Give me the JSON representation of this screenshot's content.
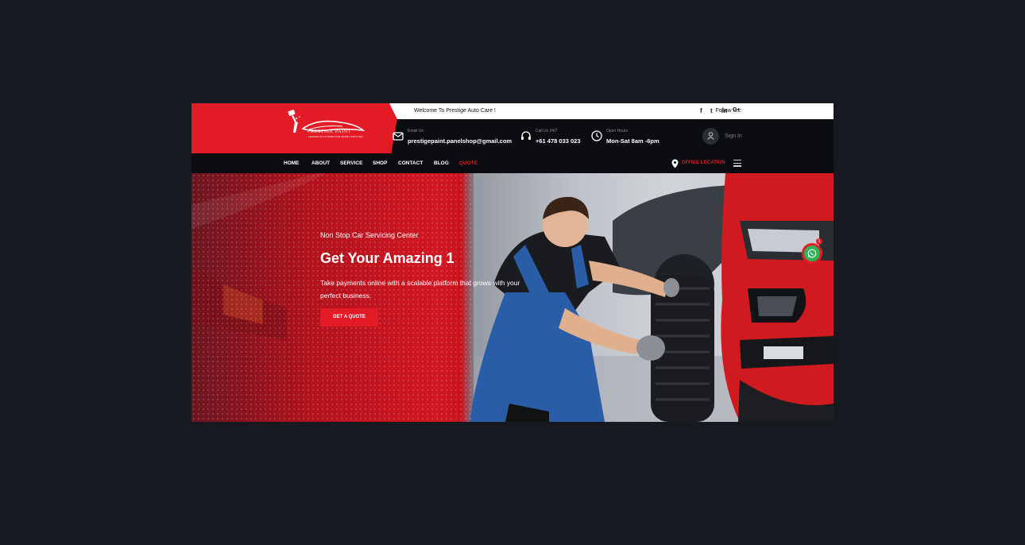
{
  "topbar": {
    "welcome": "Welcome To Prestige Auto Care !",
    "follow_label": "Follow Us:",
    "social_icons": [
      "facebook-icon",
      "twitter-icon",
      "linkedin-icon",
      "google-plus-icon"
    ],
    "social_glyphs": [
      "f",
      "t",
      "in",
      "G+"
    ]
  },
  "logo": {
    "brand": "PRESTIGE PAINT",
    "tagline": "LEADER IN AUTOMOTIVE SPRAY PAINTING"
  },
  "contact": {
    "email_label": "Email Us",
    "email": "prestigepaint.panelshop@gmail.com",
    "phone_label": "Call Us 24/7",
    "phone": "+61 478 033 023",
    "hours_label": "Open Hours",
    "hours": "Mon-Sat 8am -6pm"
  },
  "account": {
    "signin": "Sign In"
  },
  "nav": {
    "items": [
      {
        "label": "HOME"
      },
      {
        "label": "ABOUT"
      },
      {
        "label": "SERVICE"
      },
      {
        "label": "SHOP"
      },
      {
        "label": "CONTACT"
      },
      {
        "label": "BLOG"
      },
      {
        "label": "QUOTE"
      }
    ],
    "office": "OFFICE LOCATION"
  },
  "hero": {
    "subtitle": "Non Stop Car Servicing Center",
    "title": "Get Your Amazing 1",
    "description": "Take payments online with a scalable platform that grows with your perfect business.",
    "button": "GET A QUOTE"
  },
  "whatsapp": {
    "badge": "1"
  },
  "colors": {
    "accent": "#e31b27",
    "dark": "#0b0d11",
    "page_bg": "#16191f",
    "whatsapp": "#2bb35a"
  }
}
